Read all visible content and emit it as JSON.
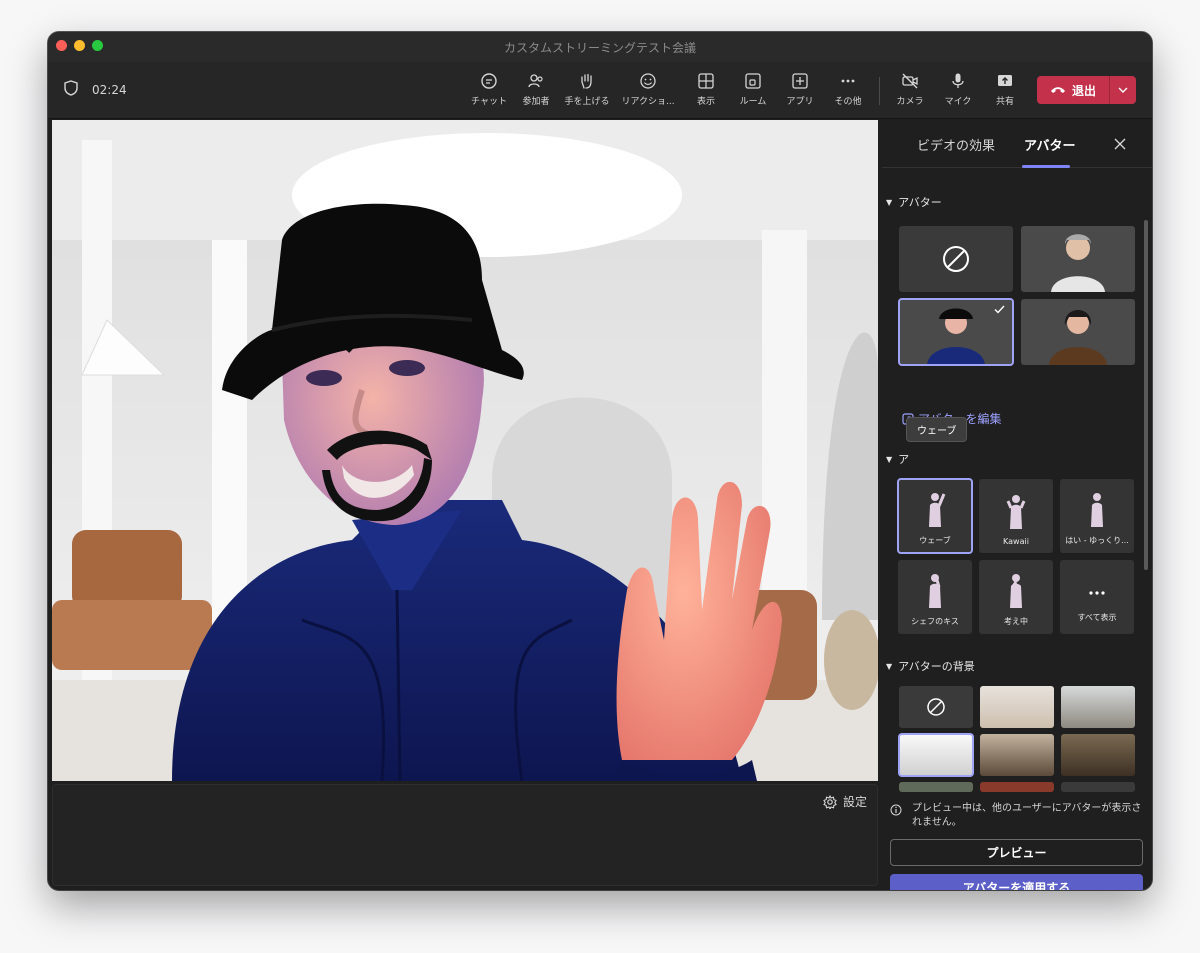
{
  "window": {
    "title": "カスタムストリーミングテスト会議"
  },
  "meeting": {
    "timer": "02:24"
  },
  "toolbar": {
    "buttons": [
      {
        "label": "チャット",
        "icon": "chat-icon"
      },
      {
        "label": "参加者",
        "icon": "people-icon"
      },
      {
        "label": "手を上げる",
        "icon": "raise-hand-icon"
      },
      {
        "label": "リアクショ...",
        "icon": "reaction-icon"
      },
      {
        "label": "表示",
        "icon": "view-icon"
      },
      {
        "label": "ルーム",
        "icon": "rooms-icon"
      },
      {
        "label": "アプリ",
        "icon": "apps-icon"
      },
      {
        "label": "その他",
        "icon": "more-icon"
      },
      {
        "label": "カメラ",
        "icon": "camera-off-icon"
      },
      {
        "label": "マイク",
        "icon": "mic-icon"
      },
      {
        "label": "共有",
        "icon": "share-icon"
      }
    ],
    "leave_label": "退出"
  },
  "stage": {
    "settings_label": "設定"
  },
  "panel": {
    "tabs": [
      {
        "label": "ビデオの効果"
      },
      {
        "label": "アバター"
      }
    ],
    "avatar_section": {
      "title": "アバター",
      "edit_label": "アバターを編集"
    },
    "reactions_section": {
      "title_visible": "ア",
      "tooltip": "ウェーブ",
      "items": [
        {
          "label": "ウェーブ"
        },
        {
          "label": "Kawaii"
        },
        {
          "label": "はい - ゆっくり..."
        },
        {
          "label": "シェフのキス"
        },
        {
          "label": "考え中"
        },
        {
          "label": "すべて表示"
        }
      ]
    },
    "background_section": {
      "title": "アバターの背景"
    },
    "notice": "プレビュー中は、他のユーザーにアバターが表示されません。",
    "preview_label": "プレビュー",
    "apply_label": "アバターを適用する"
  },
  "colors": {
    "accent": "#5b5fc7",
    "leave": "#c4314b",
    "selection": "#9fa3f5"
  }
}
